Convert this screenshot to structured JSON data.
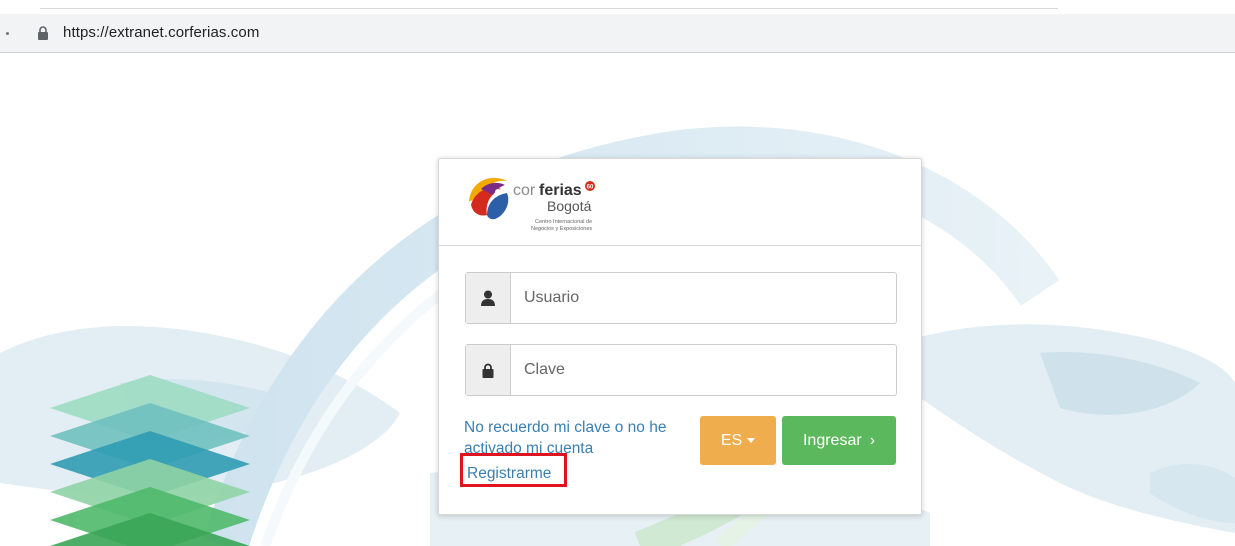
{
  "browser": {
    "url": "https://extranet.corferias.com"
  },
  "brand": {
    "name_light": "cor",
    "name_bold": "ferias",
    "city": "Bogotá",
    "tagline_line1": "Centro Internacional de",
    "tagline_line2": "Negocios y Exposiciones",
    "badge": "60"
  },
  "login": {
    "username_placeholder": "Usuario",
    "password_placeholder": "Clave",
    "forgot_link": "No recuerdo mi clave o no he activado mi cuenta",
    "register_link": "Registrarme",
    "language_button": "ES",
    "submit_button": "Ingresar",
    "submit_chevron": "›"
  },
  "icons": {
    "address_lock": "lock-icon",
    "username_addon": "user-icon",
    "password_addon": "lock-icon"
  },
  "colors": {
    "link": "#3b7fb0",
    "language_button": "#f0ad4e",
    "submit_button": "#5cb85c",
    "highlight_box": "#e0141e"
  }
}
